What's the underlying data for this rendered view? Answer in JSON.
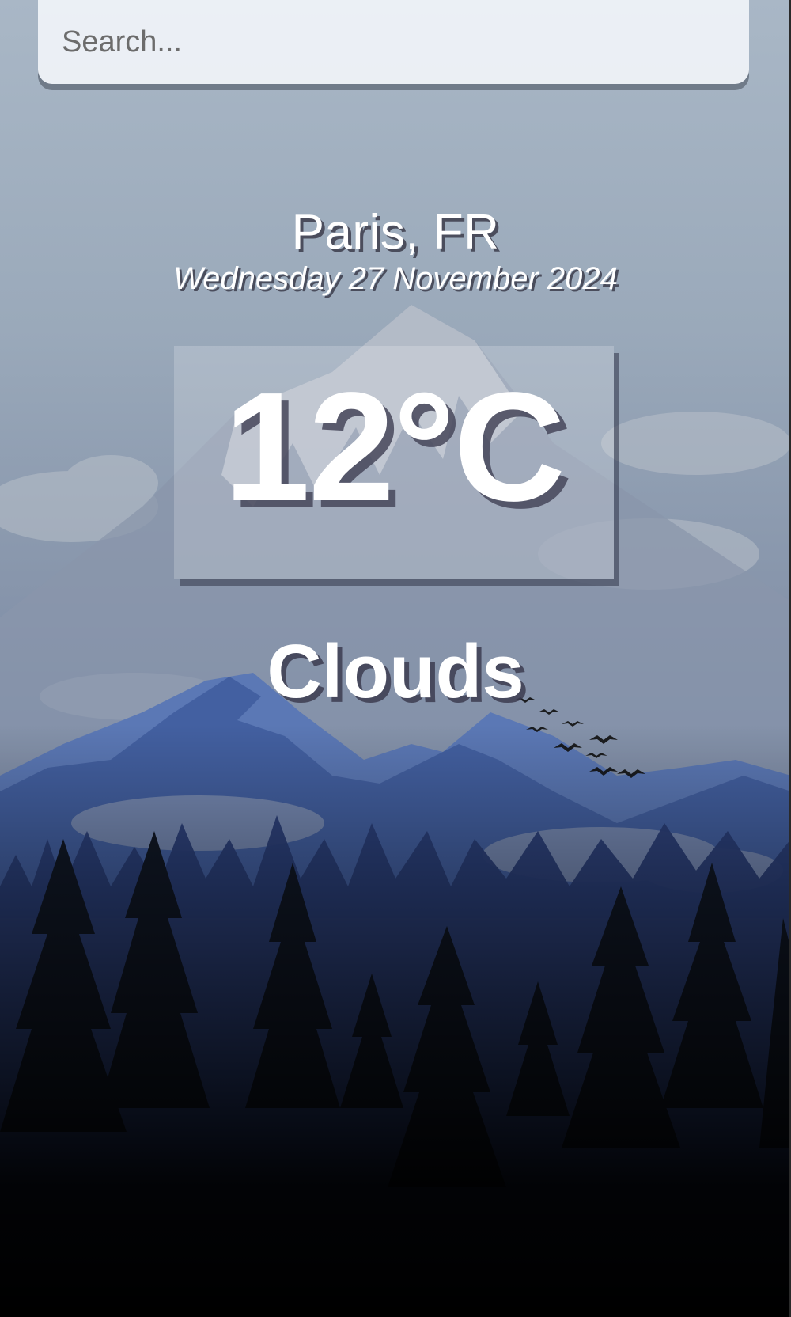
{
  "search": {
    "placeholder": "Search...",
    "value": ""
  },
  "location": {
    "city_country": "Paris, FR",
    "date": "Wednesday 27 November 2024"
  },
  "weather": {
    "temperature": "12°C",
    "condition": "Clouds"
  },
  "background": {
    "image": "mountain-forest-landscape",
    "colors": {
      "sky_top": "#a7b5c4",
      "sky_mid": "#8b9bb0",
      "mountain_far": "#5c79b0",
      "mountain_near": "#2f4a8c",
      "forest": "#0d1424"
    }
  }
}
